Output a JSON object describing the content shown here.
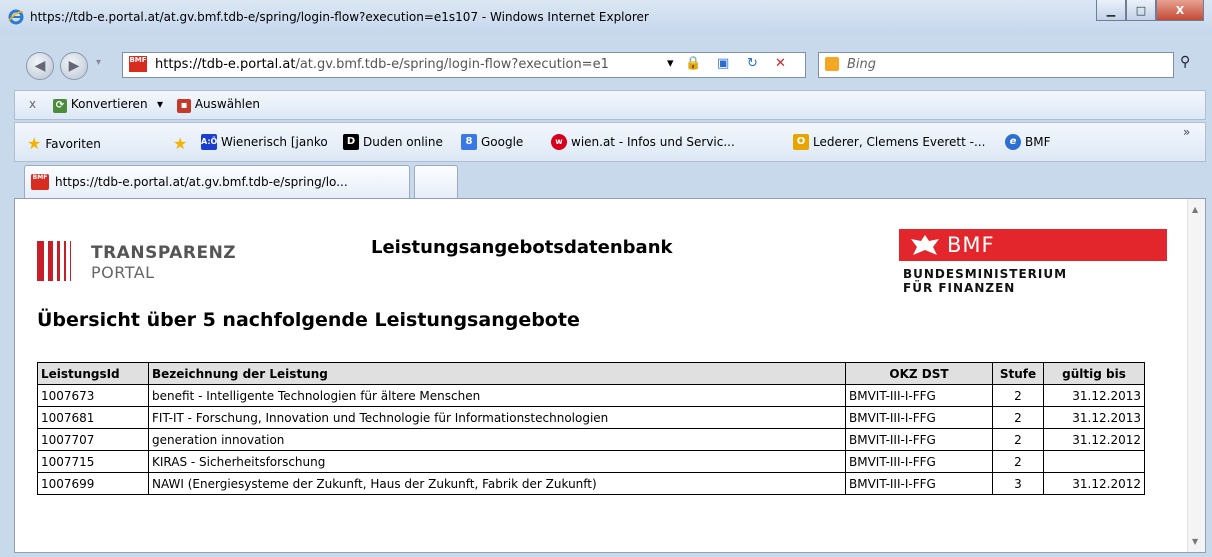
{
  "window": {
    "title": "https://tdb-e.portal.at/at.gv.bmf.tdb-e/spring/login-flow?execution=e1s107 - Windows Internet Explorer",
    "min_label": "▁",
    "max_label": "□",
    "close_label": "X"
  },
  "address": {
    "url_icon": "BMF",
    "host": "https://tdb-e.portal.at",
    "path": "/at.gv.bmf.tdb-e/spring/login-flow?execution=e1",
    "dropdown": "▾",
    "lock": "🔒",
    "refresh": "↻",
    "stop": "✕"
  },
  "search": {
    "placeholder": "Bing"
  },
  "cmdbar": {
    "close": "x",
    "convert": "Konvertieren",
    "convert_arrow": "▾",
    "select": "Auswählen"
  },
  "favbar": {
    "favorites": "Favoriten",
    "items": [
      {
        "label": "Wienerisch [janko",
        "icon_text": "A:Ö",
        "color": "#1a3fcf"
      },
      {
        "label": "Duden online",
        "icon_text": "D",
        "color": "#000000"
      },
      {
        "label": "Google",
        "icon_text": "8",
        "color": "#3a78e6"
      },
      {
        "label": "wien.at - Infos und Servic...",
        "icon_text": "w",
        "color": "#d6001c"
      },
      {
        "label": "Lederer, Clemens Everett -...",
        "icon_text": "O",
        "color": "#e8a400"
      },
      {
        "label": "BMF",
        "icon_text": "e",
        "color": "#2b6fd0"
      }
    ],
    "more": "»"
  },
  "tabs": {
    "active": "https://tdb-e.portal.at/at.gv.bmf.tdb-e/spring/lo..."
  },
  "page": {
    "tp_line1": "TRANSPARENZ",
    "tp_line2": "PORTAL",
    "title": "Leistungsangebotsdatenbank",
    "bmf": "BMF",
    "bmf_sub1": "BUNDESMINISTERIUM",
    "bmf_sub2": "FÜR FINANZEN",
    "heading": "Übersicht über 5 nachfolgende Leistungsangebote",
    "table": {
      "headers": [
        "LeistungsId",
        "Bezeichnung der Leistung",
        "OKZ DST",
        "Stufe",
        "gültig bis"
      ],
      "rows": [
        [
          "1007673",
          "benefit - Intelligente Technologien für ältere Menschen",
          "BMVIT-III-I-FFG",
          "2",
          "31.12.2013"
        ],
        [
          "1007681",
          "FIT-IT - Forschung, Innovation und Technologie für Informationstechnologien",
          "BMVIT-III-I-FFG",
          "2",
          "31.12.2013"
        ],
        [
          "1007707",
          "generation innovation",
          "BMVIT-III-I-FFG",
          "2",
          "31.12.2012"
        ],
        [
          "1007715",
          "KIRAS - Sicherheitsforschung",
          "BMVIT-III-I-FFG",
          "2",
          ""
        ],
        [
          "1007699",
          "NAWI (Energiesysteme der Zukunft, Haus der Zukunft, Fabrik der Zukunft)",
          "BMVIT-III-I-FFG",
          "3",
          "31.12.2012"
        ]
      ]
    }
  }
}
